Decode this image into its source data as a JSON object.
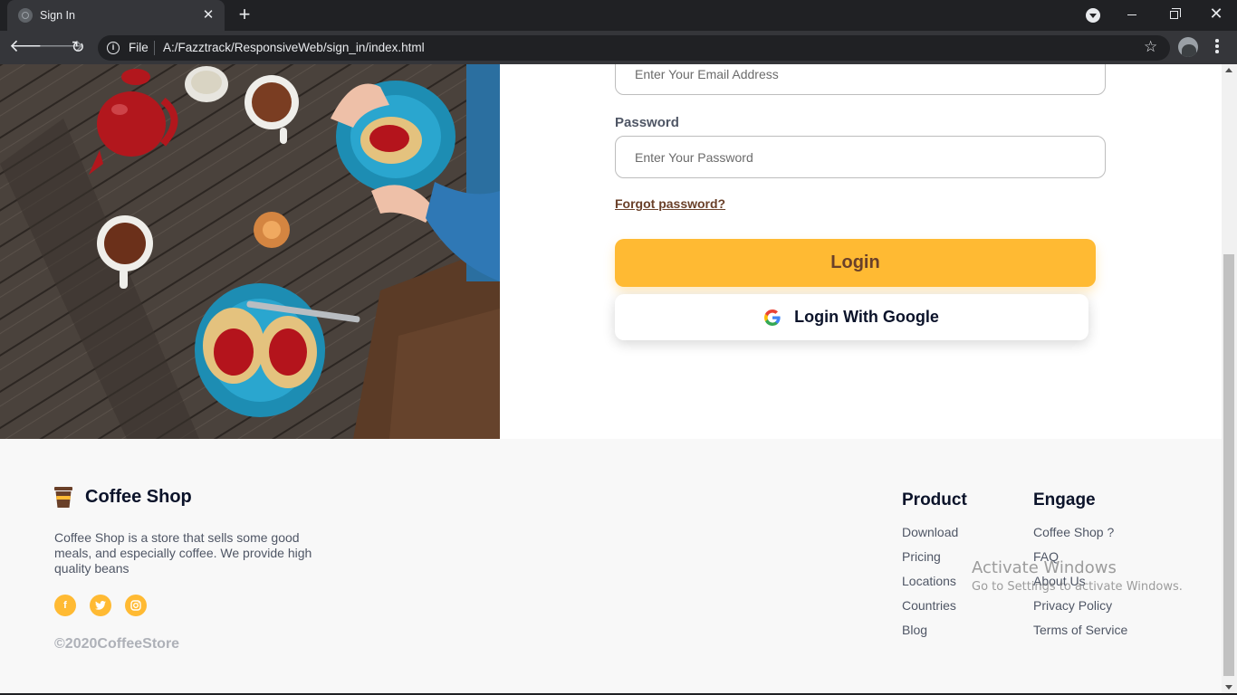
{
  "browser": {
    "tab_title": "Sign In",
    "tab_close": "✕",
    "new_tab": "+",
    "scheme_label": "File",
    "url": "A:/Fazztrack/ResponsiveWeb/sign_in/index.html"
  },
  "form": {
    "email_placeholder": "Enter Your Email Address",
    "password_label": "Password",
    "password_placeholder": "Enter Your Password",
    "forgot_label": "Forgot password?",
    "login_label": "Login",
    "google_label": "Login With Google"
  },
  "footer": {
    "brand_name": "Coffee Shop",
    "description": "Coffee Shop is a store that sells some good meals, and especially coffee. We provide high quality beans",
    "socials": [
      "facebook",
      "twitter",
      "instagram"
    ],
    "copyright": "©2020CoffeeStore",
    "product": {
      "heading": "Product",
      "links": [
        "Download",
        "Pricing",
        "Locations",
        "Countries",
        "Blog"
      ]
    },
    "engage": {
      "heading": "Engage",
      "links": [
        "Coffee Shop ?",
        "FAQ",
        "About Us",
        "Privacy Policy",
        "Terms of Service"
      ]
    }
  },
  "windows_watermark": {
    "title": "Activate Windows",
    "subtitle": "Go to Settings to activate Windows."
  },
  "colors": {
    "accent": "#ffba33",
    "brown": "#6a4029",
    "navy": "#0b132a",
    "text_gray": "#4f5665"
  }
}
